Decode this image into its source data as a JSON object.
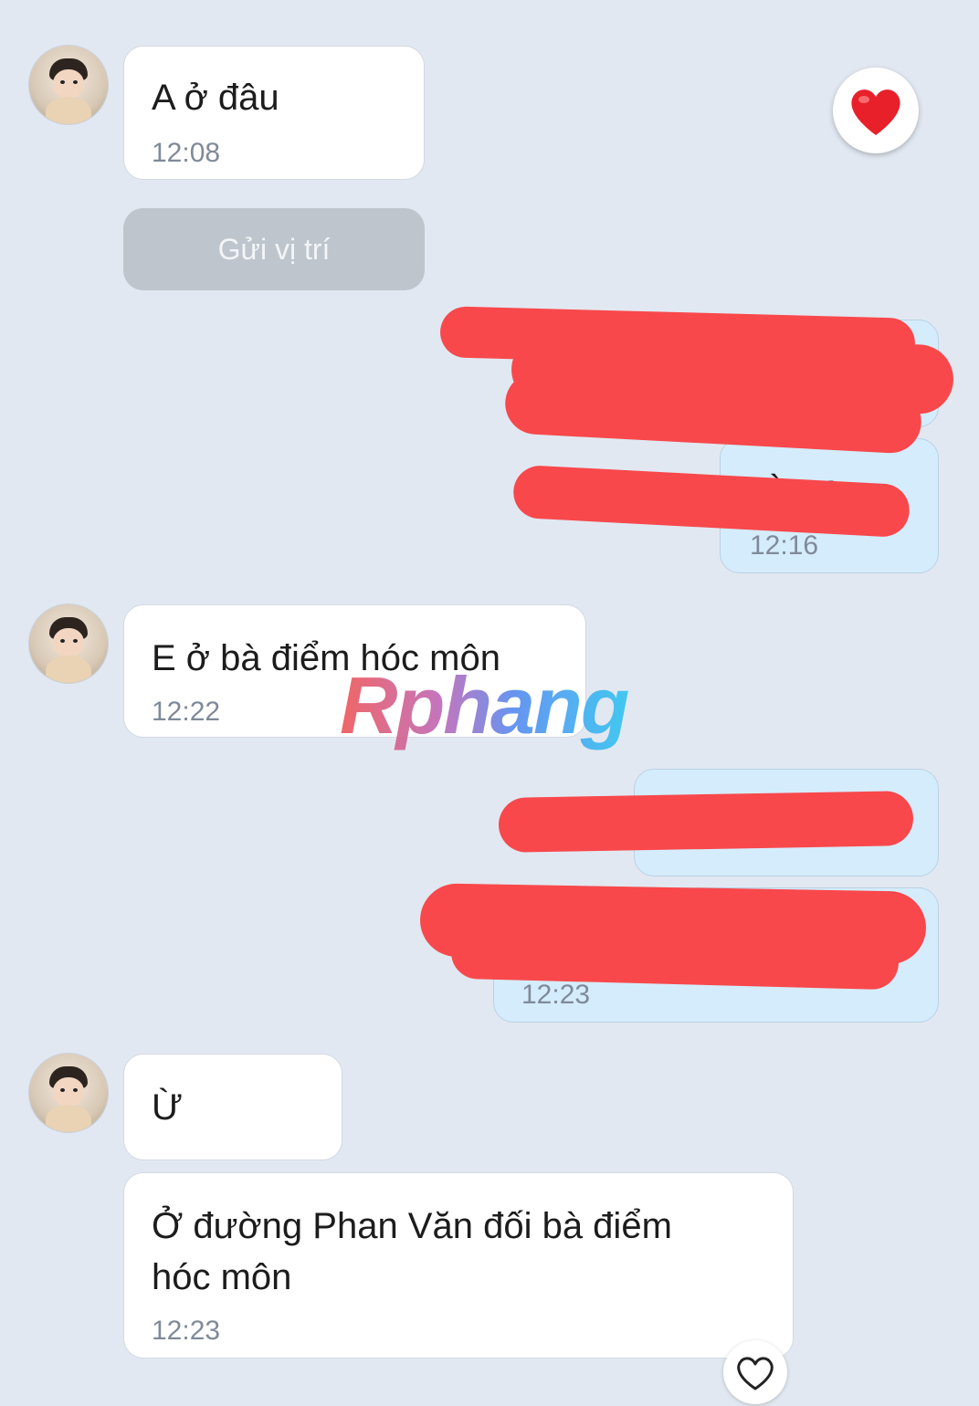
{
  "messages": [
    {
      "id": "m1",
      "text": "A ở đâu",
      "time": "12:08"
    },
    {
      "id": "m2",
      "text": "E ở bà điểm hóc môn",
      "time": "12:22"
    },
    {
      "id": "m3",
      "text": "Ừ"
    },
    {
      "id": "m4",
      "text": "Ở đường Phan Văn đối bà điểm\nhóc môn",
      "time": "12:23"
    }
  ],
  "sent": [
    {
      "id": "s2",
      "partial_text": "ờn e",
      "time": "12:16"
    },
    {
      "id": "s4",
      "time": "12:23"
    }
  ],
  "location_button_label": "Gửi vị trí",
  "watermark": "Rphang",
  "icons": {
    "reaction": "heart-icon",
    "react_button": "heart-outline-icon"
  },
  "colors": {
    "background": "#e2e8f1",
    "incoming_bubble": "#ffffff",
    "outgoing_bubble": "#d5ecfc",
    "redaction": "#f8484b",
    "heart": "#e8202a"
  }
}
